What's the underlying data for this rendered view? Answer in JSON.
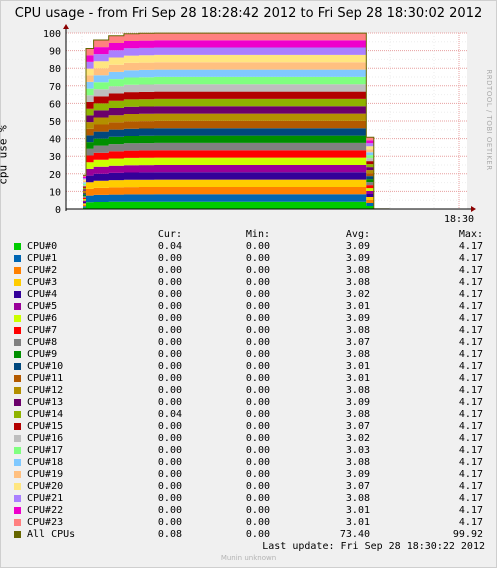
{
  "title": "CPU usage - from Fri Sep 28 18:28:42 2012 to Fri Sep 28 18:30:02 2012",
  "side_label": "RRDTOOL / TOBI OETIKER",
  "footer": {
    "last_update": "Last update:  Fri Sep 28 18:30:22 2012",
    "generator": "Munin unknown"
  },
  "legend_headers": {
    "cur": "Cur:",
    "min": "Min:",
    "avg": "Avg:",
    "max": "Max:"
  },
  "legend": [
    {
      "name": "CPU#0",
      "color": "#00cc00",
      "cur": "0.04",
      "min": "0.00",
      "avg": "3.09",
      "max": "4.17"
    },
    {
      "name": "CPU#1",
      "color": "#0066b3",
      "cur": "0.00",
      "min": "0.00",
      "avg": "3.09",
      "max": "4.17"
    },
    {
      "name": "CPU#2",
      "color": "#ff8000",
      "cur": "0.00",
      "min": "0.00",
      "avg": "3.08",
      "max": "4.17"
    },
    {
      "name": "CPU#3",
      "color": "#ffcc00",
      "cur": "0.00",
      "min": "0.00",
      "avg": "3.08",
      "max": "4.17"
    },
    {
      "name": "CPU#4",
      "color": "#330099",
      "cur": "0.00",
      "min": "0.00",
      "avg": "3.02",
      "max": "4.17"
    },
    {
      "name": "CPU#5",
      "color": "#990099",
      "cur": "0.00",
      "min": "0.00",
      "avg": "3.01",
      "max": "4.17"
    },
    {
      "name": "CPU#6",
      "color": "#ccff00",
      "cur": "0.00",
      "min": "0.00",
      "avg": "3.09",
      "max": "4.17"
    },
    {
      "name": "CPU#7",
      "color": "#ff0000",
      "cur": "0.00",
      "min": "0.00",
      "avg": "3.08",
      "max": "4.17"
    },
    {
      "name": "CPU#8",
      "color": "#808080",
      "cur": "0.00",
      "min": "0.00",
      "avg": "3.07",
      "max": "4.17"
    },
    {
      "name": "CPU#9",
      "color": "#008f00",
      "cur": "0.00",
      "min": "0.00",
      "avg": "3.08",
      "max": "4.17"
    },
    {
      "name": "CPU#10",
      "color": "#00487d",
      "cur": "0.00",
      "min": "0.00",
      "avg": "3.01",
      "max": "4.17"
    },
    {
      "name": "CPU#11",
      "color": "#b35a00",
      "cur": "0.00",
      "min": "0.00",
      "avg": "3.01",
      "max": "4.17"
    },
    {
      "name": "CPU#12",
      "color": "#b38f00",
      "cur": "0.00",
      "min": "0.00",
      "avg": "3.08",
      "max": "4.17"
    },
    {
      "name": "CPU#13",
      "color": "#6b006b",
      "cur": "0.00",
      "min": "0.00",
      "avg": "3.09",
      "max": "4.17"
    },
    {
      "name": "CPU#14",
      "color": "#8fb300",
      "cur": "0.04",
      "min": "0.00",
      "avg": "3.08",
      "max": "4.17"
    },
    {
      "name": "CPU#15",
      "color": "#b30000",
      "cur": "0.00",
      "min": "0.00",
      "avg": "3.07",
      "max": "4.17"
    },
    {
      "name": "CPU#16",
      "color": "#bebebe",
      "cur": "0.00",
      "min": "0.00",
      "avg": "3.02",
      "max": "4.17"
    },
    {
      "name": "CPU#17",
      "color": "#80ff80",
      "cur": "0.00",
      "min": "0.00",
      "avg": "3.03",
      "max": "4.17"
    },
    {
      "name": "CPU#18",
      "color": "#80c9ff",
      "cur": "0.00",
      "min": "0.00",
      "avg": "3.08",
      "max": "4.17"
    },
    {
      "name": "CPU#19",
      "color": "#ffc080",
      "cur": "0.00",
      "min": "0.00",
      "avg": "3.09",
      "max": "4.17"
    },
    {
      "name": "CPU#20",
      "color": "#ffe680",
      "cur": "0.00",
      "min": "0.00",
      "avg": "3.07",
      "max": "4.17"
    },
    {
      "name": "CPU#21",
      "color": "#aa80ff",
      "cur": "0.00",
      "min": "0.00",
      "avg": "3.08",
      "max": "4.17"
    },
    {
      "name": "CPU#22",
      "color": "#ee00cc",
      "cur": "0.00",
      "min": "0.00",
      "avg": "3.01",
      "max": "4.17"
    },
    {
      "name": "CPU#23",
      "color": "#ff8080",
      "cur": "0.00",
      "min": "0.00",
      "avg": "3.01",
      "max": "4.17"
    },
    {
      "name": "All CPUs",
      "color": "#666600",
      "cur": "0.08",
      "min": "0.00",
      "avg": "73.40",
      "max": "99.92"
    }
  ],
  "chart_data": {
    "type": "area",
    "stacked": true,
    "title": "CPU usage - from Fri Sep 28 18:28:42 2012 to Fri Sep 28 18:30:02 2012",
    "ylabel": "cpu use %",
    "xlabel": "",
    "ylim": [
      0,
      100
    ],
    "yticks": [
      0,
      10,
      20,
      30,
      40,
      50,
      60,
      70,
      80,
      90,
      100
    ],
    "xticks": [
      "18:30"
    ],
    "grid": true,
    "x": [
      "18:28:42",
      "18:28:44",
      "18:28:48",
      "18:28:52",
      "18:28:56",
      "18:29:00",
      "18:29:10",
      "18:29:20",
      "18:29:30",
      "18:29:40",
      "18:29:50",
      "18:29:56",
      "18:29:58",
      "18:30:02"
    ],
    "series": [
      {
        "name": "CPU#0",
        "values": [
          0.8,
          3.8,
          4.0,
          4.1,
          4.15,
          4.16,
          4.17,
          4.17,
          4.17,
          4.17,
          4.17,
          4.17,
          1.7,
          0.04
        ]
      },
      {
        "name": "CPU#1",
        "values": [
          0.8,
          3.8,
          4.0,
          4.1,
          4.15,
          4.16,
          4.17,
          4.17,
          4.17,
          4.17,
          4.17,
          4.17,
          1.7,
          0.0
        ]
      },
      {
        "name": "CPU#2",
        "values": [
          0.8,
          3.8,
          4.0,
          4.1,
          4.15,
          4.16,
          4.17,
          4.17,
          4.17,
          4.17,
          4.17,
          4.17,
          1.7,
          0.0
        ]
      },
      {
        "name": "CPU#3",
        "values": [
          0.8,
          3.8,
          4.0,
          4.1,
          4.15,
          4.16,
          4.17,
          4.17,
          4.17,
          4.17,
          4.17,
          4.17,
          1.7,
          0.0
        ]
      },
      {
        "name": "CPU#4",
        "values": [
          0.8,
          3.8,
          4.0,
          4.1,
          4.15,
          4.16,
          4.17,
          4.17,
          4.17,
          4.17,
          4.17,
          4.17,
          1.7,
          0.0
        ]
      },
      {
        "name": "CPU#5",
        "values": [
          0.8,
          3.8,
          4.0,
          4.1,
          4.15,
          4.16,
          4.17,
          4.17,
          4.17,
          4.17,
          4.17,
          4.17,
          1.7,
          0.0
        ]
      },
      {
        "name": "CPU#6",
        "values": [
          0.8,
          3.8,
          4.0,
          4.1,
          4.15,
          4.16,
          4.17,
          4.17,
          4.17,
          4.17,
          4.17,
          4.17,
          1.7,
          0.0
        ]
      },
      {
        "name": "CPU#7",
        "values": [
          0.8,
          3.8,
          4.0,
          4.1,
          4.15,
          4.16,
          4.17,
          4.17,
          4.17,
          4.17,
          4.17,
          4.17,
          1.7,
          0.0
        ]
      },
      {
        "name": "CPU#8",
        "values": [
          0.8,
          3.8,
          4.0,
          4.1,
          4.15,
          4.16,
          4.17,
          4.17,
          4.17,
          4.17,
          4.17,
          4.17,
          1.7,
          0.0
        ]
      },
      {
        "name": "CPU#9",
        "values": [
          0.8,
          3.8,
          4.0,
          4.1,
          4.15,
          4.16,
          4.17,
          4.17,
          4.17,
          4.17,
          4.17,
          4.17,
          1.7,
          0.0
        ]
      },
      {
        "name": "CPU#10",
        "values": [
          0.8,
          3.8,
          4.0,
          4.1,
          4.15,
          4.16,
          4.17,
          4.17,
          4.17,
          4.17,
          4.17,
          4.17,
          1.7,
          0.0
        ]
      },
      {
        "name": "CPU#11",
        "values": [
          0.8,
          3.8,
          4.0,
          4.1,
          4.15,
          4.16,
          4.17,
          4.17,
          4.17,
          4.17,
          4.17,
          4.17,
          1.7,
          0.0
        ]
      },
      {
        "name": "CPU#12",
        "values": [
          0.8,
          3.8,
          4.0,
          4.1,
          4.15,
          4.16,
          4.17,
          4.17,
          4.17,
          4.17,
          4.17,
          4.17,
          1.7,
          0.0
        ]
      },
      {
        "name": "CPU#13",
        "values": [
          0.8,
          3.8,
          4.0,
          4.1,
          4.15,
          4.16,
          4.17,
          4.17,
          4.17,
          4.17,
          4.17,
          4.17,
          1.7,
          0.0
        ]
      },
      {
        "name": "CPU#14",
        "values": [
          0.8,
          3.8,
          4.0,
          4.1,
          4.15,
          4.16,
          4.17,
          4.17,
          4.17,
          4.17,
          4.17,
          4.17,
          1.7,
          0.04
        ]
      },
      {
        "name": "CPU#15",
        "values": [
          0.8,
          3.8,
          4.0,
          4.1,
          4.15,
          4.16,
          4.17,
          4.17,
          4.17,
          4.17,
          4.17,
          4.17,
          1.7,
          0.0
        ]
      },
      {
        "name": "CPU#16",
        "values": [
          0.8,
          3.8,
          4.0,
          4.1,
          4.15,
          4.16,
          4.17,
          4.17,
          4.17,
          4.17,
          4.17,
          4.17,
          1.7,
          0.0
        ]
      },
      {
        "name": "CPU#17",
        "values": [
          0.8,
          3.8,
          4.0,
          4.1,
          4.15,
          4.16,
          4.17,
          4.17,
          4.17,
          4.17,
          4.17,
          4.17,
          1.7,
          0.0
        ]
      },
      {
        "name": "CPU#18",
        "values": [
          0.8,
          3.8,
          4.0,
          4.1,
          4.15,
          4.16,
          4.17,
          4.17,
          4.17,
          4.17,
          4.17,
          4.17,
          1.7,
          0.0
        ]
      },
      {
        "name": "CPU#19",
        "values": [
          0.8,
          3.8,
          4.0,
          4.1,
          4.15,
          4.16,
          4.17,
          4.17,
          4.17,
          4.17,
          4.17,
          4.17,
          1.7,
          0.0
        ]
      },
      {
        "name": "CPU#20",
        "values": [
          0.8,
          3.8,
          4.0,
          4.1,
          4.15,
          4.16,
          4.17,
          4.17,
          4.17,
          4.17,
          4.17,
          4.17,
          1.7,
          0.0
        ]
      },
      {
        "name": "CPU#21",
        "values": [
          0.8,
          3.8,
          4.0,
          4.1,
          4.15,
          4.16,
          4.17,
          4.17,
          4.17,
          4.17,
          4.17,
          4.17,
          1.7,
          0.0
        ]
      },
      {
        "name": "CPU#22",
        "values": [
          0.8,
          3.8,
          4.0,
          4.1,
          4.15,
          4.16,
          4.17,
          4.17,
          4.17,
          4.17,
          4.17,
          4.17,
          1.7,
          0.0
        ]
      },
      {
        "name": "CPU#23",
        "values": [
          0.8,
          3.8,
          4.0,
          4.1,
          4.15,
          4.16,
          4.17,
          4.17,
          4.17,
          4.17,
          4.17,
          4.17,
          1.7,
          0.0
        ]
      }
    ],
    "total_line": {
      "name": "All CPUs",
      "values": [
        19.2,
        91.2,
        96.0,
        98.4,
        99.6,
        99.84,
        99.92,
        99.92,
        99.92,
        99.92,
        99.92,
        99.92,
        40.8,
        0.08
      ]
    }
  }
}
